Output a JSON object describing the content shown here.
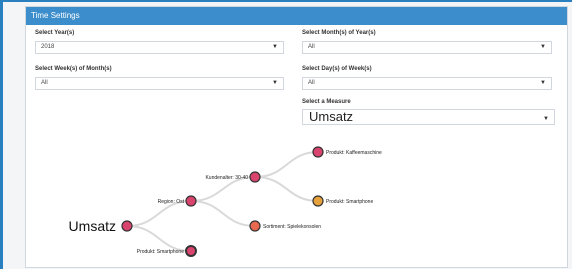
{
  "panel": {
    "title": "Time Settings"
  },
  "filters": {
    "year": {
      "label": "Select Year(s)",
      "value": "2018"
    },
    "month": {
      "label": "Select Month(s) of Year(s)",
      "value": "All"
    },
    "week": {
      "label": "Select Week(s) of Month(s)",
      "value": "All"
    },
    "day": {
      "label": "Select Day(s) of Week(s)",
      "value": "All"
    },
    "measure": {
      "label": "Select a Measure",
      "value": "Umsatz"
    }
  },
  "tree": {
    "root_label": "Umsatz",
    "nodes": {
      "region": "Region: Ost",
      "kunde": "Kundenalter: 30-40",
      "kaffee": "Produkt: Kaffeemaschine",
      "smart1": "Produkt: Smartphone",
      "sortiment": "Sortiment: Spielekonsolen",
      "smart2": "Produkt: Smartphone"
    },
    "colors": {
      "pink": "#d9446e",
      "orange_pink": "#e8694f",
      "orange": "#e6a23c",
      "link": "#d9d9d9",
      "stroke": "#333333"
    }
  }
}
